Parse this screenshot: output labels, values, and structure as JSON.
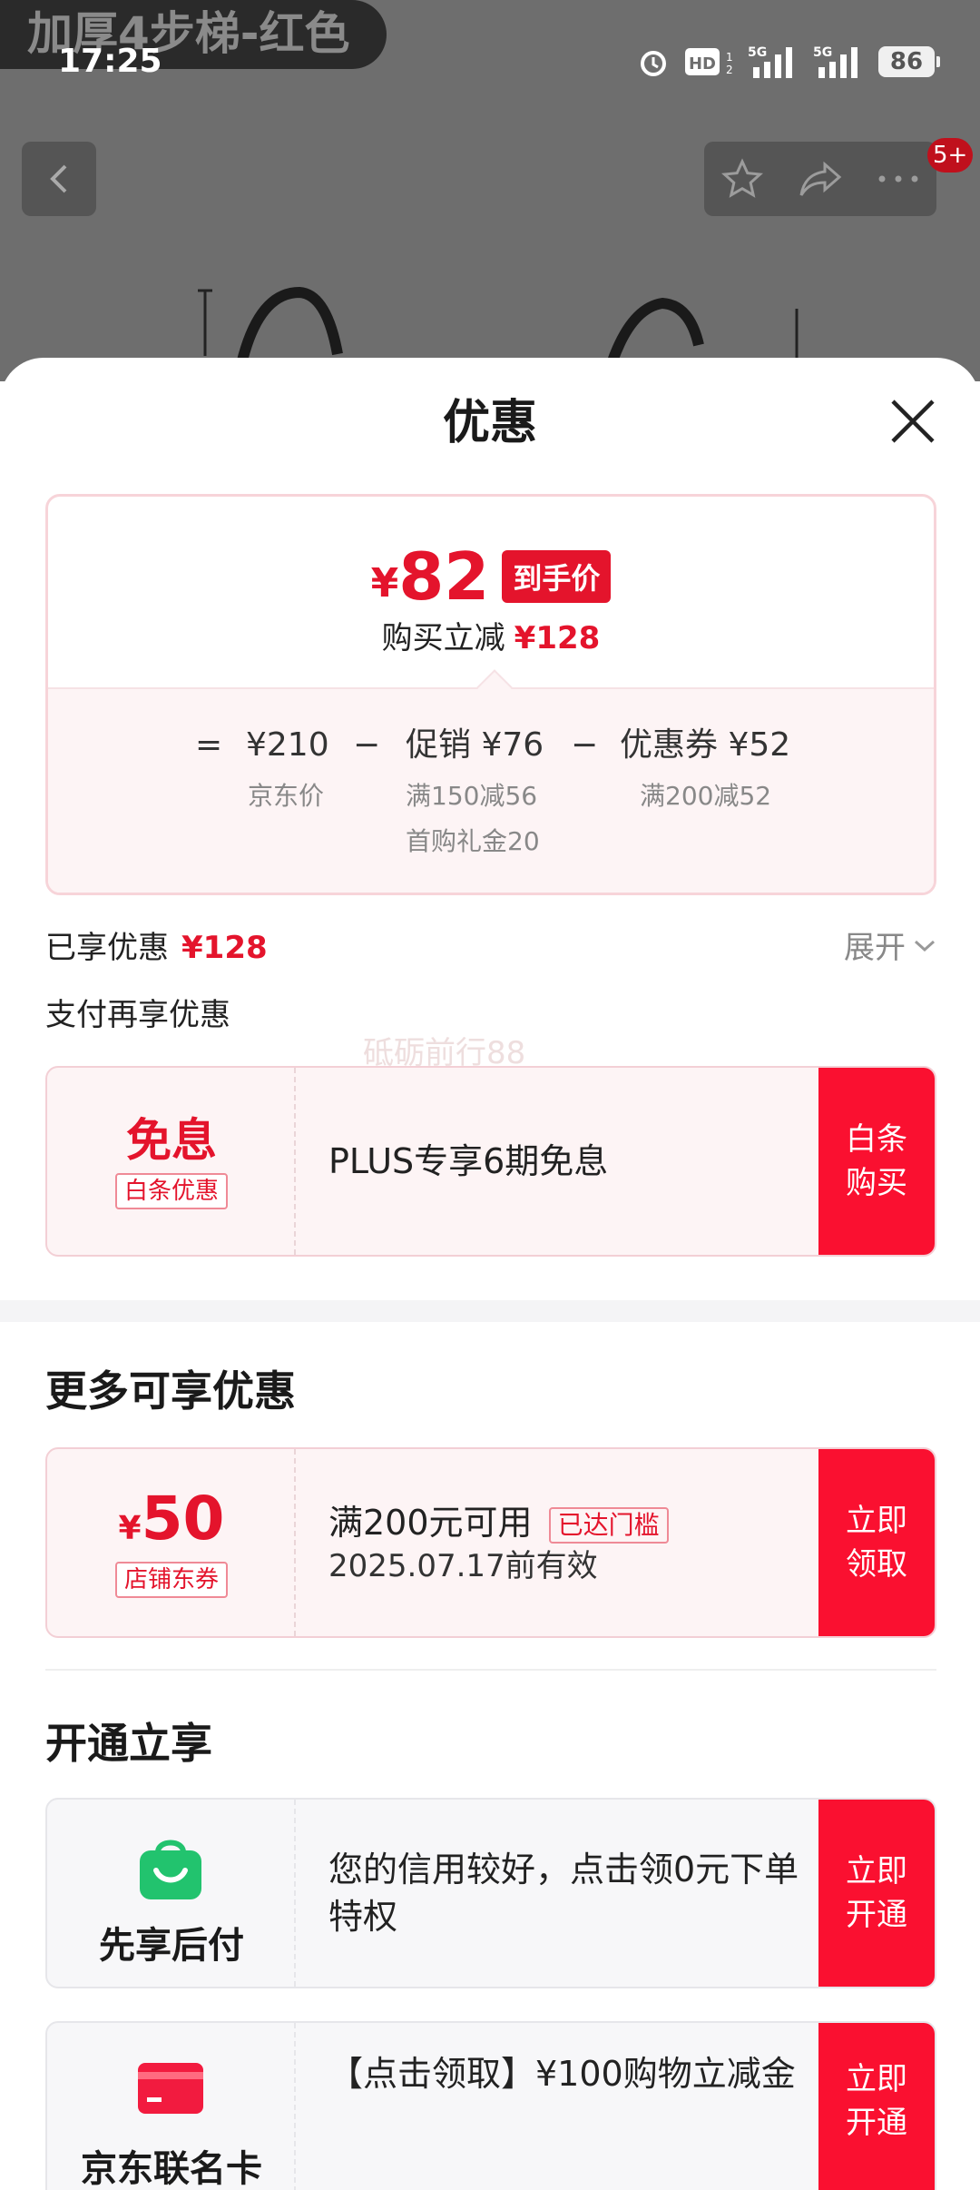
{
  "status_bar": {
    "time": "17:25",
    "battery": "86",
    "network": "5G"
  },
  "background": {
    "title_tag": "加厚4步梯-红色",
    "badge": "5+"
  },
  "sheet": {
    "title": "优惠",
    "summary": {
      "yen": "¥",
      "price": "82",
      "price_tag": "到手价",
      "discount_label": "购买立减",
      "discount_value": "¥128",
      "equals": "=",
      "jd_price": "¥210",
      "jd_price_label": "京东价",
      "minus1": "−",
      "promo": "促销 ¥76",
      "promo_detail1": "满150减56",
      "promo_detail2": "首购礼金20",
      "minus2": "−",
      "coupon": "优惠券 ¥52",
      "coupon_detail": "满200减52"
    },
    "saved_label": "已享优惠",
    "saved_value": "¥128",
    "expand_label": "展开",
    "pay_label": "支付再享优惠",
    "watermark": "砥砺前行88",
    "baitiao": {
      "title": "免息",
      "tag": "白条优惠",
      "text": "PLUS专享6期免息",
      "cta_line1": "白条",
      "cta_line2": "购买"
    },
    "more_title": "更多可享优惠",
    "shop_coupon": {
      "yen": "¥",
      "amount": "50",
      "tag": "店铺东券",
      "condition": "满200元可用",
      "status_tag": "已达门槛",
      "validity": "2025.07.17前有效",
      "cta_line1": "立即",
      "cta_line2": "领取"
    },
    "open_title": "开通立享",
    "pay_later": {
      "name": "先享后付",
      "text": "您的信用较好，点击领0元下单特权",
      "cta_line1": "立即",
      "cta_line2": "开通"
    },
    "jd_card": {
      "name": "京东联名卡",
      "text": "【点击领取】¥100购物立减金",
      "cta_line1": "立即",
      "cta_line2": "开通"
    }
  },
  "colors": {
    "accent": "#e4142c",
    "cta": "#fa1030",
    "pay_later_green": "#22c36e"
  }
}
